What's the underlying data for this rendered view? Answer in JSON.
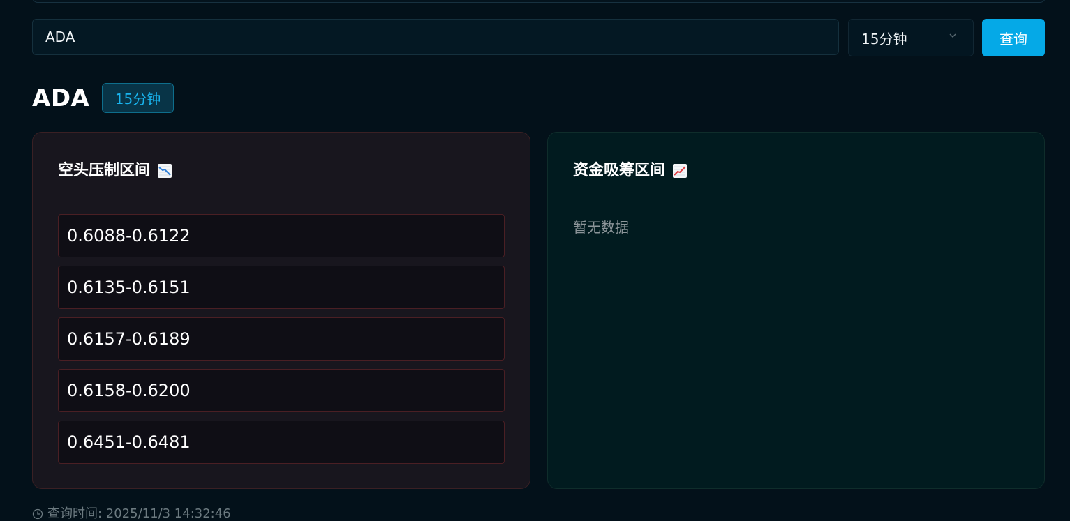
{
  "search": {
    "value": "ADA",
    "placeholder": ""
  },
  "interval_select": {
    "selected": "15分钟"
  },
  "query_button": {
    "label": "查询"
  },
  "result": {
    "symbol": "ADA",
    "interval_badge": "15分钟"
  },
  "short_zone": {
    "title": "空头压制区间",
    "icon": "chart-decreasing-icon",
    "ranges": [
      "0.6088-0.6122",
      "0.6135-0.6151",
      "0.6157-0.6189",
      "0.6158-0.6200",
      "0.6451-0.6481"
    ]
  },
  "long_zone": {
    "title": "资金吸筹区间",
    "icon": "chart-increasing-icon",
    "empty_text": "暂无数据"
  },
  "footer": {
    "query_time": "查询时间: 2025/11/3 14:32:46",
    "icon": "clock-icon"
  },
  "colors": {
    "accent": "#05a9e7",
    "background": "#03111a",
    "short_card_bg": "#18161e",
    "long_card_bg": "#011b1f",
    "range_border": "#4a1f24"
  }
}
